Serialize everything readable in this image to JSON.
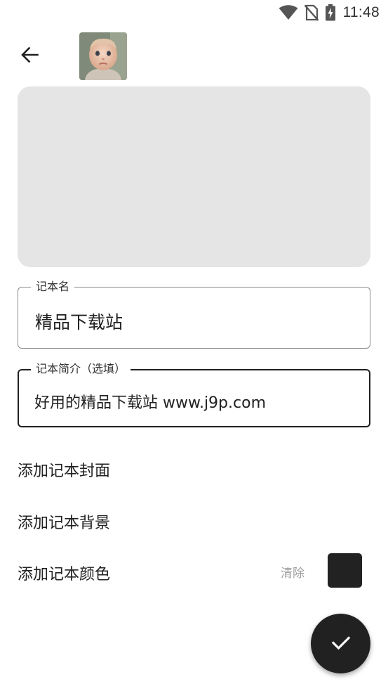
{
  "status_bar": {
    "time": "11:48",
    "icons": [
      "wifi-icon",
      "no-sim-icon",
      "battery-charging-icon"
    ]
  },
  "toolbar": {
    "back_icon": "arrow-left-icon",
    "avatar": "baby-photo-avatar"
  },
  "cover_placeholder": {
    "color": "#e5e5e5"
  },
  "form": {
    "name": {
      "label": "记本名",
      "value": "精品下载站"
    },
    "description": {
      "label": "记本简介（选填）",
      "value": "好用的精品下载站 www.j9p.com"
    }
  },
  "options": {
    "add_cover": "添加记本封面",
    "add_background": "添加记本背景",
    "add_color": "添加记本颜色",
    "clear": "清除",
    "selected_color": "#222222"
  },
  "fab": {
    "icon": "check-icon"
  },
  "colors": {
    "primary": "#212121",
    "background": "#ffffff",
    "placeholder": "#e5e5e5",
    "muted_text": "#9e9e9e"
  }
}
